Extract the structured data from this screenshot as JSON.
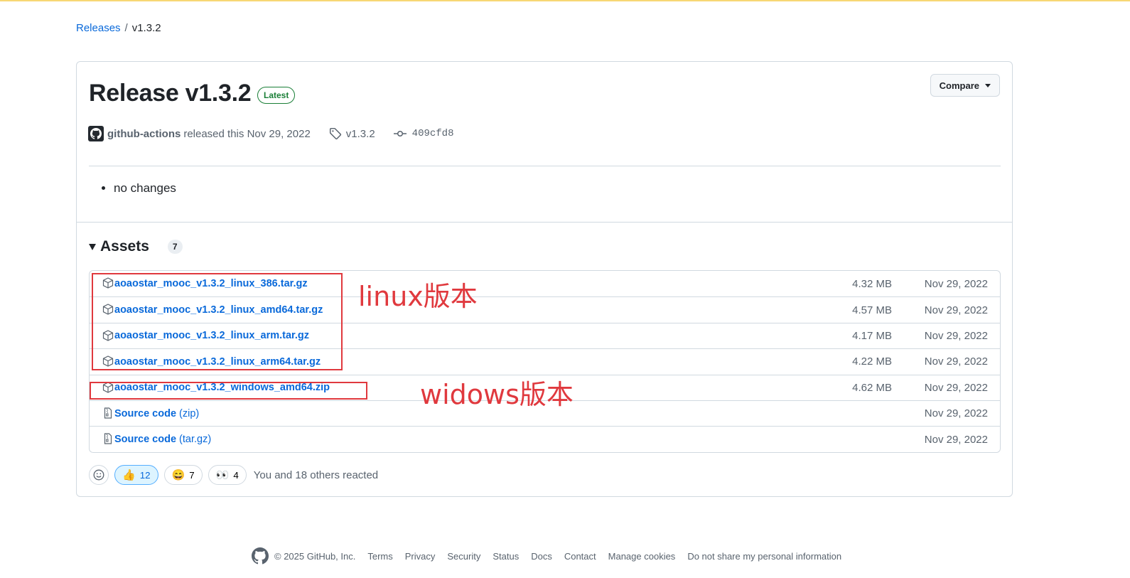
{
  "breadcrumb": {
    "parent": "Releases",
    "separator": "/",
    "current": "v1.3.2"
  },
  "release": {
    "title": "Release v1.3.2",
    "badge": "Latest",
    "compare_label": "Compare",
    "author": "github-actions",
    "released_text": "released this",
    "date": "Nov 29, 2022",
    "tag": "v1.3.2",
    "commit": "409cfd8",
    "notes": [
      "no changes"
    ]
  },
  "assets": {
    "title": "Assets",
    "count": "7",
    "items": [
      {
        "name": "aoaostar_mooc_v1.3.2_linux_386.tar.gz",
        "suffix": "",
        "size": "4.32 MB",
        "date": "Nov 29, 2022",
        "icon": "package-icon"
      },
      {
        "name": "aoaostar_mooc_v1.3.2_linux_amd64.tar.gz",
        "suffix": "",
        "size": "4.57 MB",
        "date": "Nov 29, 2022",
        "icon": "package-icon"
      },
      {
        "name": "aoaostar_mooc_v1.3.2_linux_arm.tar.gz",
        "suffix": "",
        "size": "4.17 MB",
        "date": "Nov 29, 2022",
        "icon": "package-icon"
      },
      {
        "name": "aoaostar_mooc_v1.3.2_linux_arm64.tar.gz",
        "suffix": "",
        "size": "4.22 MB",
        "date": "Nov 29, 2022",
        "icon": "package-icon"
      },
      {
        "name": "aoaostar_mooc_v1.3.2_windows_amd64.zip",
        "suffix": "",
        "size": "4.62 MB",
        "date": "Nov 29, 2022",
        "icon": "package-icon"
      },
      {
        "name": "Source code",
        "suffix": " (zip)",
        "size": "",
        "date": "Nov 29, 2022",
        "icon": "file-zip-icon"
      },
      {
        "name": "Source code",
        "suffix": " (tar.gz)",
        "size": "",
        "date": "Nov 29, 2022",
        "icon": "file-zip-icon"
      }
    ]
  },
  "reactions": {
    "thumbs_up": "12",
    "smile": "7",
    "eyes": "4",
    "summary": "You and 18 others reacted"
  },
  "annotations": {
    "linux_label": "linux版本",
    "windows_label": "widows版本",
    "color": "#e0393e"
  },
  "footer": {
    "copyright": "© 2025 GitHub, Inc.",
    "links": [
      "Terms",
      "Privacy",
      "Security",
      "Status",
      "Docs",
      "Contact",
      "Manage cookies",
      "Do not share my personal information"
    ]
  },
  "colors": {
    "link": "#0969da",
    "latest": "#1a7f37",
    "border": "#d1d9e0",
    "muted": "#59636e"
  }
}
